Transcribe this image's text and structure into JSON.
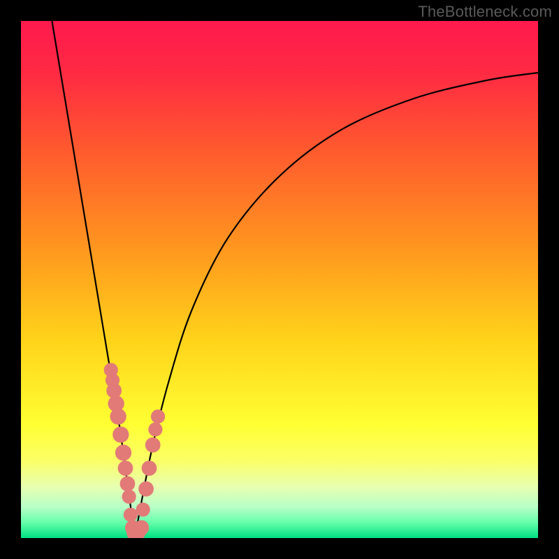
{
  "watermark": "TheBottleneck.com",
  "chart_data": {
    "type": "line",
    "title": "",
    "xlabel": "",
    "ylabel": "",
    "xlim": [
      0,
      100
    ],
    "ylim": [
      0,
      100
    ],
    "gradient_stops": [
      {
        "pos": 0.0,
        "color": "#ff1a4d"
      },
      {
        "pos": 0.1,
        "color": "#ff2a43"
      },
      {
        "pos": 0.25,
        "color": "#ff5a2e"
      },
      {
        "pos": 0.45,
        "color": "#ff9a1e"
      },
      {
        "pos": 0.62,
        "color": "#ffd41a"
      },
      {
        "pos": 0.78,
        "color": "#ffff33"
      },
      {
        "pos": 0.85,
        "color": "#fbff66"
      },
      {
        "pos": 0.9,
        "color": "#e8ffb0"
      },
      {
        "pos": 0.94,
        "color": "#b8ffc8"
      },
      {
        "pos": 0.97,
        "color": "#66ffaa"
      },
      {
        "pos": 1.0,
        "color": "#00e082"
      }
    ],
    "series": [
      {
        "name": "left-branch",
        "x": [
          6.0,
          8.0,
          10.0,
          12.0,
          14.0,
          16.0,
          17.5,
          19.0,
          20.0,
          20.8,
          21.5,
          22.0
        ],
        "y": [
          100,
          88,
          76,
          64,
          52,
          40,
          31,
          22,
          15,
          9,
          4,
          0
        ]
      },
      {
        "name": "right-branch",
        "x": [
          22.0,
          23.5,
          25.5,
          28.5,
          33.0,
          40.0,
          50.0,
          62.0,
          76.0,
          90.0,
          100.0
        ],
        "y": [
          0,
          8,
          18,
          30,
          44,
          58,
          70,
          79,
          85,
          88.5,
          90
        ]
      }
    ],
    "markers": {
      "name": "data-dots",
      "color": "#e27a78",
      "points": [
        {
          "x": 17.4,
          "y": 32.5,
          "r": 1.3
        },
        {
          "x": 17.7,
          "y": 30.5,
          "r": 1.3
        },
        {
          "x": 18.0,
          "y": 28.5,
          "r": 1.4
        },
        {
          "x": 18.4,
          "y": 26.0,
          "r": 1.5
        },
        {
          "x": 18.8,
          "y": 23.5,
          "r": 1.5
        },
        {
          "x": 19.3,
          "y": 20.0,
          "r": 1.5
        },
        {
          "x": 19.8,
          "y": 16.5,
          "r": 1.5
        },
        {
          "x": 20.2,
          "y": 13.5,
          "r": 1.4
        },
        {
          "x": 20.6,
          "y": 10.5,
          "r": 1.4
        },
        {
          "x": 20.9,
          "y": 8.0,
          "r": 1.3
        },
        {
          "x": 21.2,
          "y": 4.5,
          "r": 1.3
        },
        {
          "x": 21.6,
          "y": 2.0,
          "r": 1.4
        },
        {
          "x": 22.0,
          "y": 1.0,
          "r": 1.5
        },
        {
          "x": 22.6,
          "y": 1.2,
          "r": 1.5
        },
        {
          "x": 23.3,
          "y": 2.0,
          "r": 1.4
        },
        {
          "x": 23.6,
          "y": 5.5,
          "r": 1.3
        },
        {
          "x": 24.2,
          "y": 9.5,
          "r": 1.4
        },
        {
          "x": 24.8,
          "y": 13.5,
          "r": 1.4
        },
        {
          "x": 25.5,
          "y": 18.0,
          "r": 1.4
        },
        {
          "x": 26.0,
          "y": 21.0,
          "r": 1.3
        },
        {
          "x": 26.5,
          "y": 23.5,
          "r": 1.3
        }
      ]
    }
  }
}
